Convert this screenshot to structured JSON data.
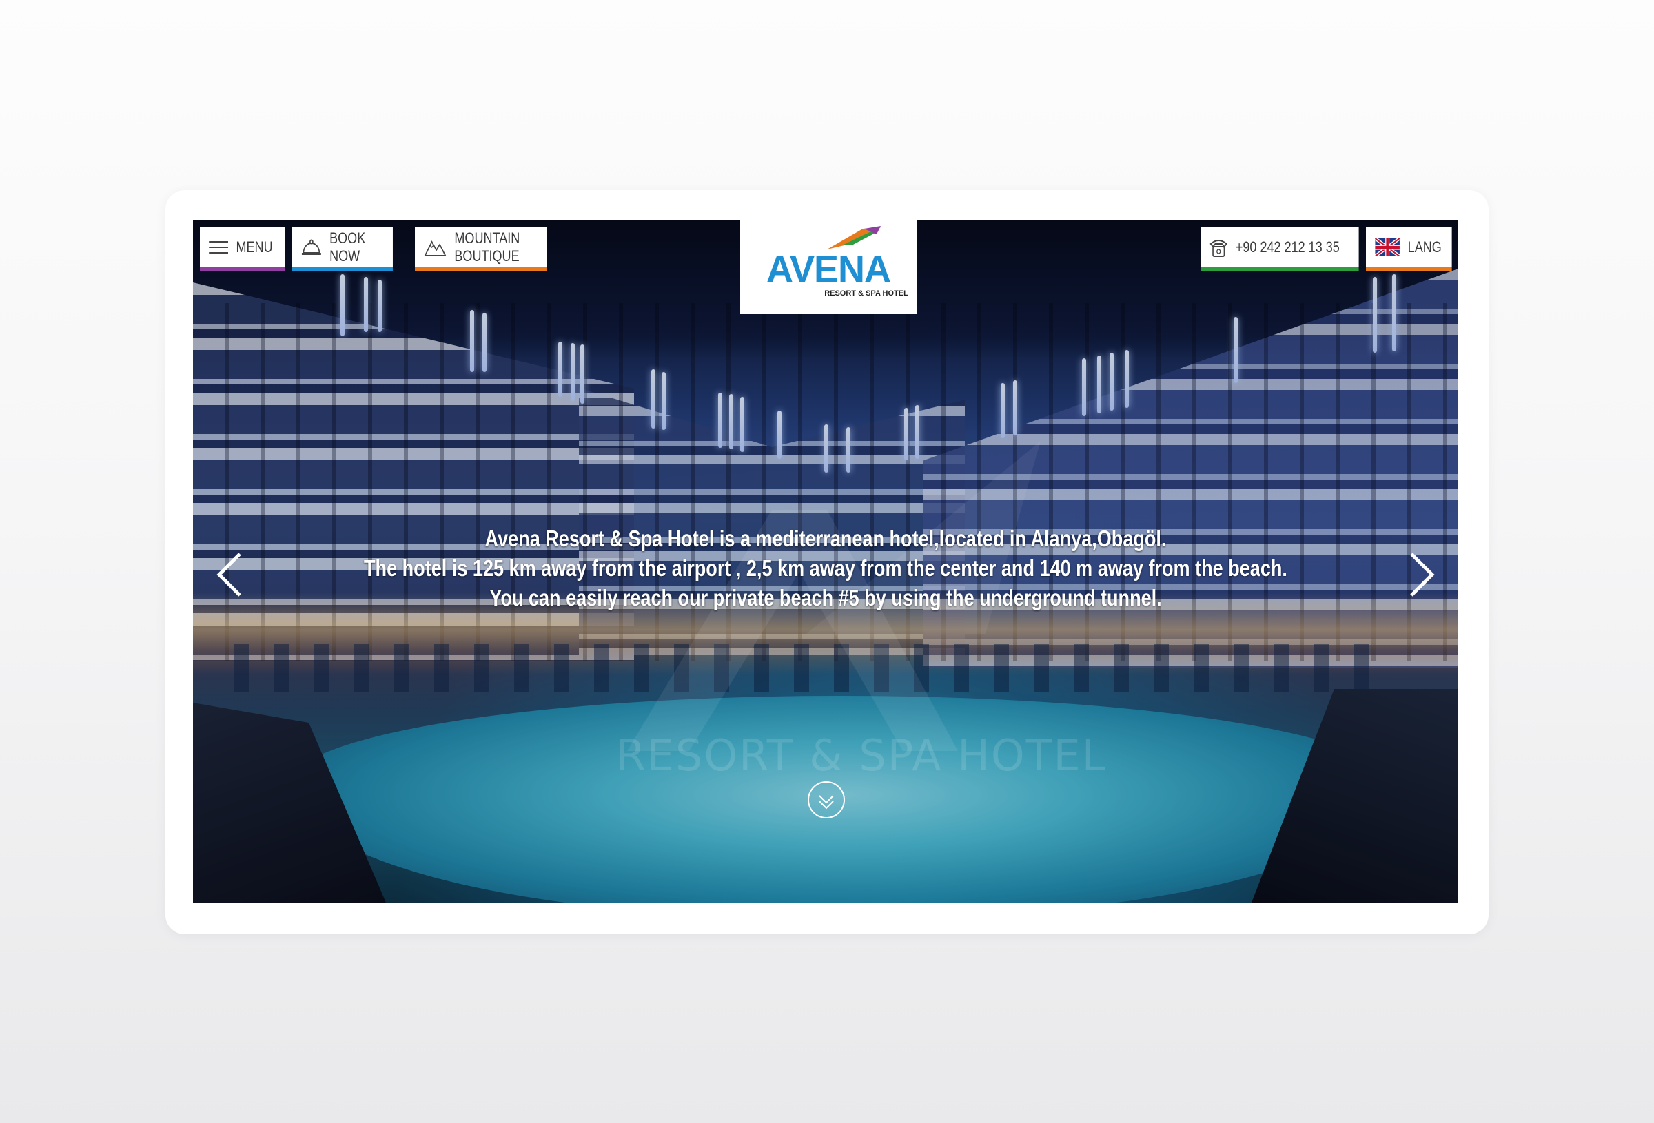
{
  "nav": {
    "menu_label": "MENU",
    "book_label": "BOOK NOW",
    "mountain_label": "MOUNTAIN BOUTIQUE",
    "phone_label": "+90 242 212 13 35",
    "lang_label": "LANG"
  },
  "accent_colors": {
    "menu": "#8e3fa0",
    "book": "#1f8fd3",
    "mountain": "#e87a1e",
    "phone": "#2e9d3f",
    "lang": "#e87a1e"
  },
  "logo": {
    "name": "AVENA",
    "subtitle": "RESORT & SPA HOTEL"
  },
  "hero": {
    "caption_lines": [
      "Avena Resort & Spa Hotel is a mediterranean hotel,located in Alanya,Obagöl.",
      "The hotel is 125 km away from the airport , 2,5 km away from the center and 140 m away from the beach.",
      "You can easily reach our private beach #5 by using the underground tunnel."
    ],
    "watermark": "RESORT & SPA HOTEL"
  },
  "icons": {
    "menu": "hamburger-icon",
    "book": "service-bell-icon",
    "mountain": "mountain-icon",
    "phone": "telephone-icon",
    "lang": "uk-flag-icon",
    "prev": "chevron-left-icon",
    "next": "chevron-right-icon",
    "scroll": "double-chevron-down-icon"
  }
}
